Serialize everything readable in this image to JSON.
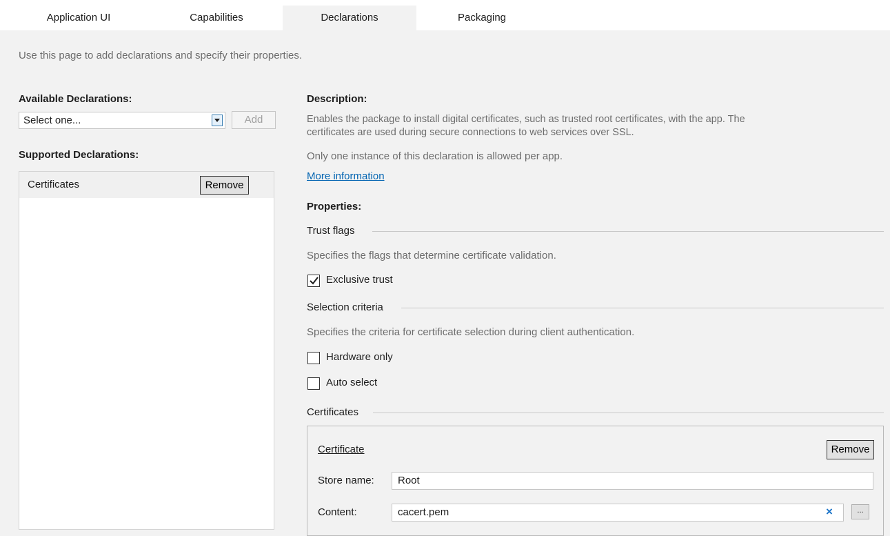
{
  "tabs": [
    {
      "label": "Application UI"
    },
    {
      "label": "Capabilities"
    },
    {
      "label": "Declarations"
    },
    {
      "label": "Packaging"
    }
  ],
  "intro": "Use this page to add declarations and specify their properties.",
  "available": {
    "heading": "Available Declarations:",
    "select_value": "Select one...",
    "add_label": "Add"
  },
  "supported": {
    "heading": "Supported Declarations:",
    "items": [
      {
        "label": "Certificates",
        "remove_label": "Remove"
      }
    ]
  },
  "description": {
    "heading": "Description:",
    "line1": "Enables the package to install digital certificates, such as trusted root certificates, with the app. The",
    "line2": "certificates are used during secure connections to web services over SSL.",
    "note": "Only one instance of this declaration is allowed per app.",
    "more_link": "More information"
  },
  "properties": {
    "heading": "Properties:",
    "trust": {
      "title": "Trust flags",
      "desc": "Specifies the flags that determine certificate validation.",
      "exclusive_label": "Exclusive trust",
      "exclusive_checked": true
    },
    "selection": {
      "title": "Selection criteria",
      "desc": "Specifies the criteria for certificate selection during client authentication.",
      "hardware_label": "Hardware only",
      "hardware_checked": false,
      "auto_label": "Auto select",
      "auto_checked": false
    },
    "certificates": {
      "title": "Certificates",
      "entry": {
        "title": "Certificate",
        "remove_label": "Remove",
        "store_label": "Store name:",
        "store_value": "Root",
        "content_label": "Content:",
        "content_value": "cacert.pem",
        "clear_icon": "×",
        "browse_label": "..."
      }
    }
  },
  "colors": {
    "link": "#0063b1",
    "background": "#f2f2f2"
  }
}
